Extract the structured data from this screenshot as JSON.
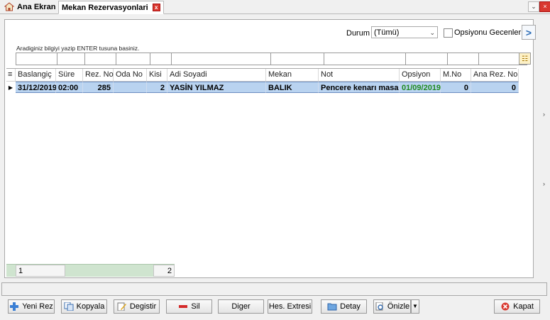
{
  "tabs": {
    "home_label": "Ana Ekran",
    "active_label": "Mekan Rezervasyonlari",
    "close_glyph": "x"
  },
  "filter": {
    "durum_label": "Durum",
    "durum_value": "(Tümü)",
    "opsiyon_label": "Opsiyonu Gecenler",
    "hint": "Aradiginiz bilgiyi yazip ENTER tusuna basiniz.",
    "nav_glyph": ">"
  },
  "grid": {
    "columns": [
      "Baslangiç",
      "Süre",
      "Rez. No",
      "Oda No",
      "Kisi",
      "Adi Soyadi",
      "Mekan",
      "Not",
      "Opsiyon",
      "M.No",
      "Ana Rez. No"
    ],
    "rows": [
      {
        "baslangic": "31/12/2019",
        "sure": "02:00",
        "rez_no": "285",
        "oda_no": "",
        "kisi": "2",
        "adi_soyadi": "YASİN YILMAZ",
        "mekan": "BALIK",
        "not": "Pencere kenarı masa",
        "opsiyon": "01/09/2019",
        "m_no": "0",
        "ana_rez_no": "0"
      }
    ],
    "footer": {
      "count": "1",
      "kisi_total": "2"
    }
  },
  "buttons": {
    "yeni_rez": "Yeni Rez",
    "kopyala": "Kopyala",
    "degistir": "Degistir",
    "sil": "Sil",
    "diger": "Diger",
    "hes_extresi": "Hes. Extresi",
    "detay": "Detay",
    "onizle": "Önizle",
    "kapat": "Kapat"
  },
  "colors": {
    "selected_row": "#b9d3f0",
    "footer": "#cfe4cf",
    "option_date": "#1f8a1f",
    "accent_blue": "#2a6bb5"
  }
}
